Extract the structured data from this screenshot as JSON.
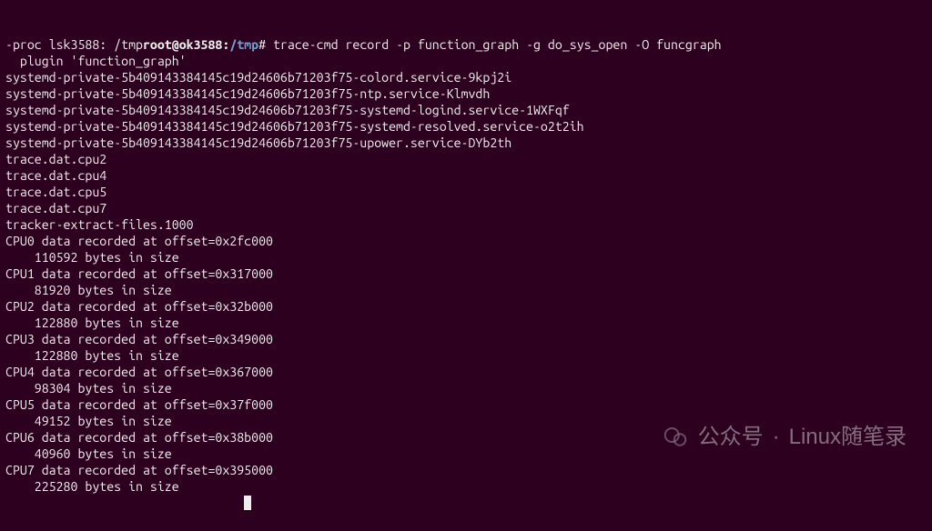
{
  "prompt": {
    "prefix": "-proc lsk3588: /tmp",
    "user": "root@ok3588",
    "sep": ":",
    "path": "/tmp",
    "symbol": "#",
    "command": "trace-cmd record -p function_graph -g do_sys_open -O funcgraph"
  },
  "output_lines": [
    "  plugin 'function_graph'",
    "systemd-private-5b409143384145c19d24606b71203f75-colord.service-9kpj2i",
    "systemd-private-5b409143384145c19d24606b71203f75-ntp.service-Klmvdh",
    "systemd-private-5b409143384145c19d24606b71203f75-systemd-logind.service-1WXFqf",
    "systemd-private-5b409143384145c19d24606b71203f75-systemd-resolved.service-o2t2ih",
    "systemd-private-5b409143384145c19d24606b71203f75-upower.service-DYb2th",
    "trace.dat.cpu2",
    "trace.dat.cpu4",
    "trace.dat.cpu5",
    "trace.dat.cpu7",
    "tracker-extract-files.1000",
    "CPU0 data recorded at offset=0x2fc000",
    "    110592 bytes in size",
    "CPU1 data recorded at offset=0x317000",
    "    81920 bytes in size",
    "CPU2 data recorded at offset=0x32b000",
    "    122880 bytes in size",
    "CPU3 data recorded at offset=0x349000",
    "    122880 bytes in size",
    "CPU4 data recorded at offset=0x367000",
    "    98304 bytes in size",
    "CPU5 data recorded at offset=0x37f000",
    "    49152 bytes in size",
    "CPU6 data recorded at offset=0x38b000",
    "    40960 bytes in size",
    "CPU7 data recorded at offset=0x395000",
    "    225280 bytes in size"
  ],
  "watermark": {
    "label": "公众号",
    "sep": "·",
    "name": "Linux随笔录"
  }
}
